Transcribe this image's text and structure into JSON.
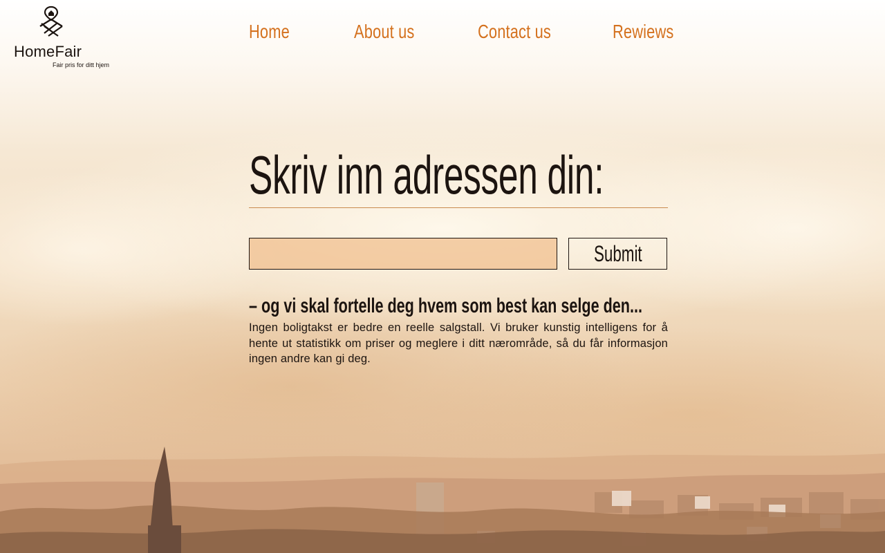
{
  "brand": {
    "name": "HomeFair",
    "tagline": "Fair pris for ditt hjem",
    "logo_icon": "house-pin-logo-icon"
  },
  "nav": {
    "items": [
      {
        "label": "Home"
      },
      {
        "label": "About us"
      },
      {
        "label": "Contact us"
      },
      {
        "label": "Rewiews"
      }
    ]
  },
  "hero": {
    "headline": "Skriv inn adressen din:",
    "address_input": {
      "value": "",
      "placeholder": ""
    },
    "submit_label": "Submit",
    "subheading": "– og vi skal fortelle deg hvem som best kan selge den...",
    "description": "Ingen boligtakst er bedre en reelle salgstall. Vi bruker kunstig intelligens for å hente ut statistikk om priser og meglere i ditt nærområde, så du får informasjon ingen andre kan gi deg."
  },
  "colors": {
    "accent": "#d4711e",
    "text": "#1c1410",
    "input_fill": "#f0be8c",
    "rule": "#c98a4e"
  }
}
